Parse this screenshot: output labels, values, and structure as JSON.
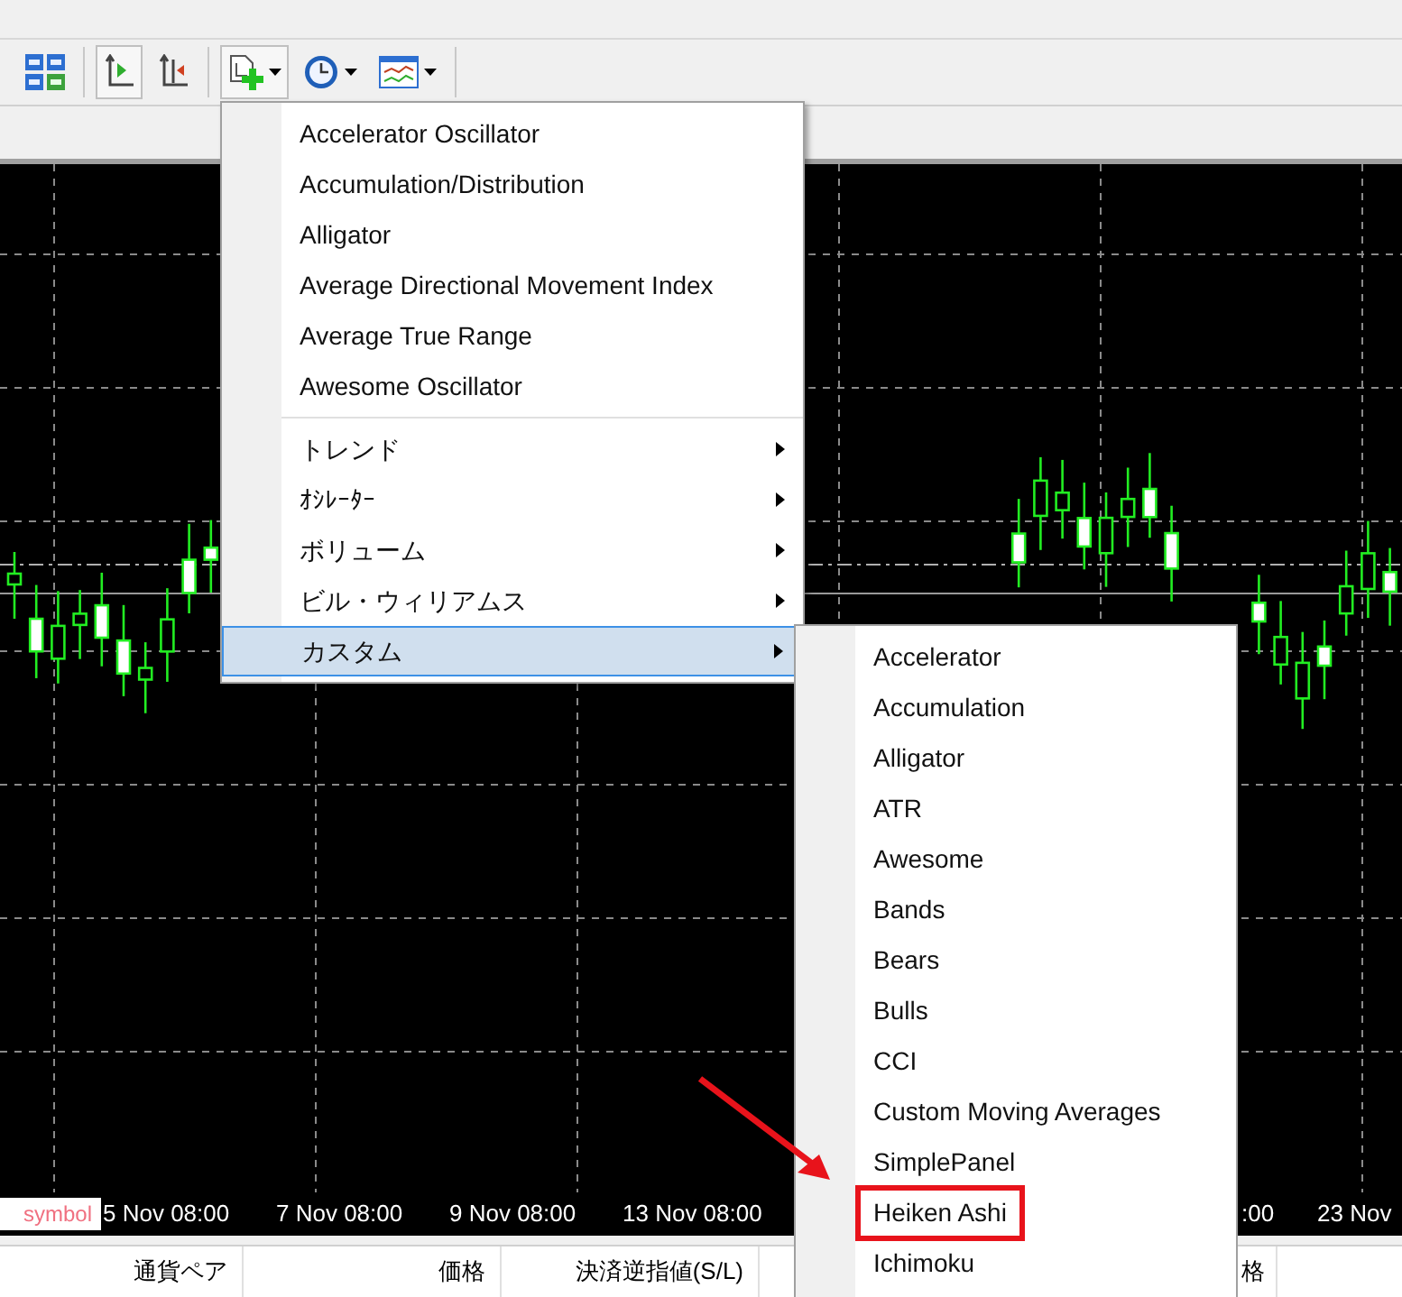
{
  "toolbar": {
    "buttons": [
      {
        "kind": "layout",
        "pressed": false,
        "caret": false
      },
      {
        "kind": "divider"
      },
      {
        "kind": "autoscroll",
        "pressed": true,
        "caret": false
      },
      {
        "kind": "shift",
        "pressed": false,
        "caret": false
      },
      {
        "kind": "divider"
      },
      {
        "kind": "indicators",
        "pressed": true,
        "caret": true
      },
      {
        "kind": "periods",
        "pressed": false,
        "caret": true
      },
      {
        "kind": "templates",
        "pressed": false,
        "caret": true
      },
      {
        "kind": "divider"
      }
    ]
  },
  "indicator_menu": {
    "items": [
      {
        "kind": "item",
        "label": "Accelerator Oscillator",
        "has_submenu": false,
        "selected": false
      },
      {
        "kind": "item",
        "label": "Accumulation/Distribution",
        "has_submenu": false,
        "selected": false
      },
      {
        "kind": "item",
        "label": "Alligator",
        "has_submenu": false,
        "selected": false
      },
      {
        "kind": "item",
        "label": "Average Directional Movement Index",
        "has_submenu": false,
        "selected": false
      },
      {
        "kind": "item",
        "label": "Average True Range",
        "has_submenu": false,
        "selected": false
      },
      {
        "kind": "item",
        "label": "Awesome Oscillator",
        "has_submenu": false,
        "selected": false
      },
      {
        "kind": "separator"
      },
      {
        "kind": "item",
        "label": "トレンド",
        "has_submenu": true,
        "selected": false
      },
      {
        "kind": "item",
        "label": "ｵｼﾚｰﾀｰ",
        "has_submenu": true,
        "selected": false
      },
      {
        "kind": "item",
        "label": "ボリューム",
        "has_submenu": true,
        "selected": false
      },
      {
        "kind": "item",
        "label": "ビル・ウィリアムス",
        "has_submenu": true,
        "selected": false
      },
      {
        "kind": "item",
        "label": "カスタム",
        "has_submenu": true,
        "selected": true
      }
    ]
  },
  "custom_menu": {
    "items": [
      {
        "label": "Accelerator",
        "highlighted": false
      },
      {
        "label": "Accumulation",
        "highlighted": false
      },
      {
        "label": "Alligator",
        "highlighted": false
      },
      {
        "label": "ATR",
        "highlighted": false
      },
      {
        "label": "Awesome",
        "highlighted": false
      },
      {
        "label": "Bands",
        "highlighted": false
      },
      {
        "label": "Bears",
        "highlighted": false
      },
      {
        "label": "Bulls",
        "highlighted": false
      },
      {
        "label": "CCI",
        "highlighted": false
      },
      {
        "label": "Custom Moving Averages",
        "highlighted": false
      },
      {
        "label": "SimplePanel",
        "highlighted": false
      },
      {
        "label": "Heiken Ashi",
        "highlighted": true
      },
      {
        "label": "Ichimoku",
        "highlighted": false
      }
    ]
  },
  "chart": {
    "symbol_label": "symbol",
    "time_labels_left": [
      "5 Nov 08:00",
      "7 Nov 08:00",
      "9 Nov 08:00",
      "13 Nov 08:00"
    ],
    "time_labels_right": [
      ":00",
      "23 Nov"
    ]
  },
  "table": {
    "columns_left": [
      "通貨ペア",
      "価格",
      "決済逆指値(S/L)"
    ],
    "columns_right": [
      "格"
    ]
  }
}
